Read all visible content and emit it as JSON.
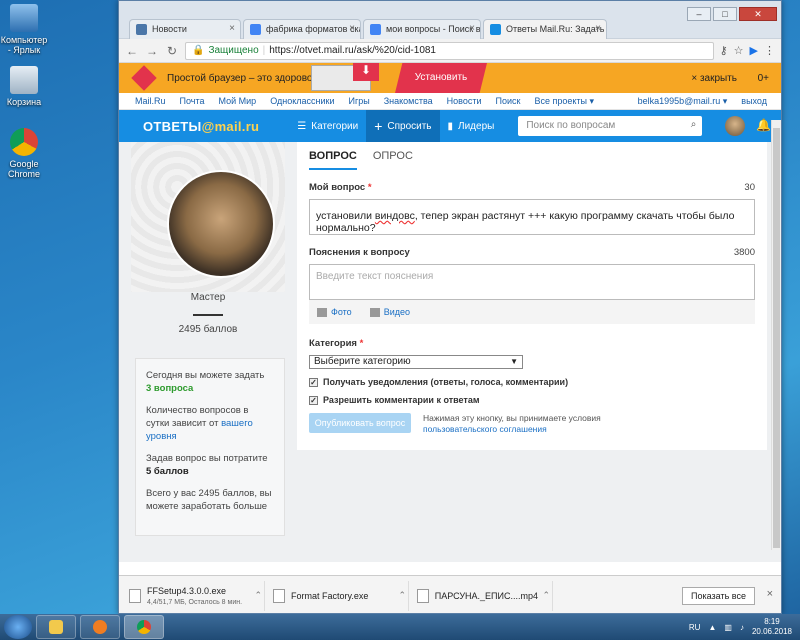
{
  "desktop": {
    "icons": [
      {
        "label": "Компьютер - Ярлык"
      },
      {
        "label": "Корзина"
      },
      {
        "label": "Google Chrome"
      }
    ]
  },
  "browser": {
    "tabs": [
      {
        "label": "Новости"
      },
      {
        "label": "фабрика форматов скач"
      },
      {
        "label": "мои вопросы - Поиск в"
      },
      {
        "label": "Ответы Mail.Ru: Задать в"
      }
    ],
    "address": {
      "secure_label": "Защищено",
      "url": "https://otvet.mail.ru/ask/%20/cid-1081"
    }
  },
  "promo": {
    "text": "Простой браузер – это здорово",
    "install_label": "Установить",
    "close_label": "закрыть",
    "age": "0+"
  },
  "portal_nav": {
    "items": [
      "Mail.Ru",
      "Почта",
      "Мой Мир",
      "Одноклассники",
      "Игры",
      "Знакомства",
      "Новости",
      "Поиск",
      "Все проекты ▾"
    ],
    "user": "belka1995b@mail.ru ▾",
    "exit": "выход"
  },
  "header": {
    "brand_left": "ОТВЕТЫ",
    "brand_right": "@mail.ru",
    "categories": "Категории",
    "ask": "Спросить",
    "leaders": "Лидеры",
    "search_placeholder": "Поиск по вопросам"
  },
  "profile": {
    "rank": "Мастер",
    "points": "2495 баллов",
    "info": {
      "today_label": "Сегодня вы можете задать",
      "today_value": "3 вопроса",
      "count_text": "Количество вопросов в сутки зависит от",
      "count_link": "вашего уровня",
      "spend_label": "Задав вопрос вы потратите",
      "spend_value": "5 баллов",
      "earn_text": "Всего у вас 2495 баллов, вы можете заработать больше"
    }
  },
  "form": {
    "tabs": [
      "ВОПРОС",
      "ОПРОС"
    ],
    "question_label": "Мой вопрос",
    "question_counter": "30",
    "question_prefix": "установили ",
    "question_misspelled": "виндовс",
    "question_rest": ", тепер экран растянут +++ какую программу скачать чтобы было нормально?",
    "explain_label": "Пояснения к вопросу",
    "explain_counter": "3800",
    "explain_placeholder": "Введите текст пояснения",
    "photo_label": "Фото",
    "video_label": "Видео",
    "category_label": "Категория",
    "category_value": "Выберите категорию",
    "notify_label": "Получать уведомления (ответы, голоса, комментарии)",
    "comments_label": "Разрешить комментарии к ответам",
    "publish_label": "Опубликовать вопрос",
    "terms_text": "Нажимая эту кнопку, вы принимаете условия",
    "terms_link": "пользовательского соглашения"
  },
  "downloads": {
    "items": [
      {
        "name": "FFSetup4.3.0.0.exe",
        "sub": "4,4/51,7 МБ, Осталось 8 мин."
      },
      {
        "name": "Format Factory.exe",
        "sub": ""
      },
      {
        "name": "ПАРСУНА._ЕПИС....mp4",
        "sub": ""
      }
    ],
    "show_all": "Показать все"
  },
  "taskbar": {
    "lang": "RU",
    "time": "8:19",
    "date": "20.06.2018"
  }
}
